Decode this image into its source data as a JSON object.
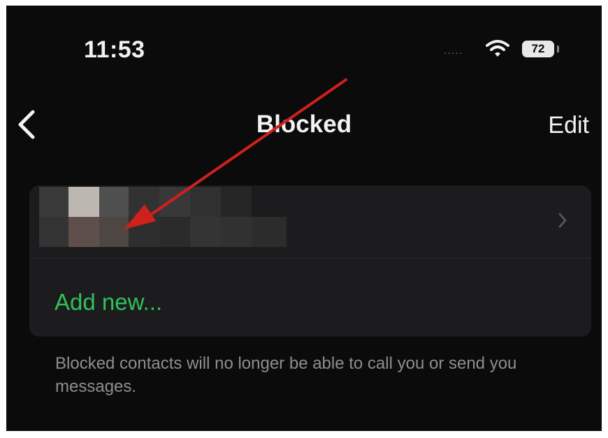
{
  "status_bar": {
    "time": "11:53",
    "signal": ".....",
    "battery": "72"
  },
  "nav": {
    "title": "Blocked",
    "edit_label": "Edit"
  },
  "list": {
    "add_new_label": "Add new..."
  },
  "footer": {
    "text": "Blocked contacts will no longer be able to call you or send you messages."
  },
  "colors": {
    "background": "#0b0b0b",
    "card": "#1c1c1e",
    "accent_green": "#30c15a",
    "annotation_red": "#d0201e",
    "secondary_text": "#8e8e93"
  },
  "icons": {
    "back": "chevron-left-icon",
    "row_disclosure": "chevron-right-icon",
    "wifi": "wifi-icon",
    "battery": "battery-icon"
  }
}
